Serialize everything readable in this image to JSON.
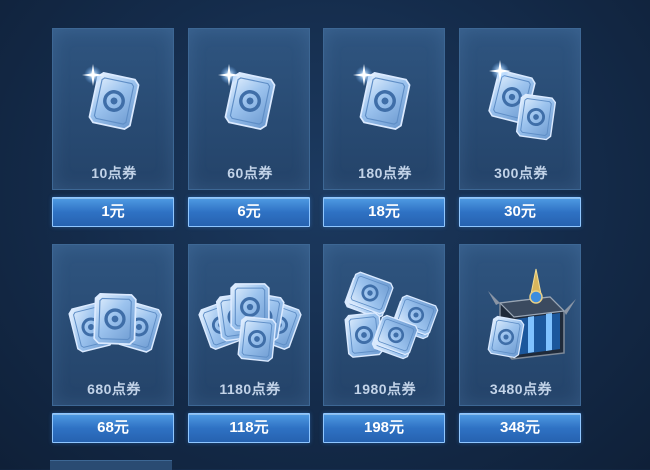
{
  "shop": {
    "items": [
      {
        "amount": "10点券",
        "price": "1元",
        "icon": "single-coupon-icon"
      },
      {
        "amount": "60点券",
        "price": "6元",
        "icon": "single-coupon-icon"
      },
      {
        "amount": "180点券",
        "price": "18元",
        "icon": "single-coupon-icon"
      },
      {
        "amount": "300点券",
        "price": "30元",
        "icon": "double-coupon-icon"
      },
      {
        "amount": "680点券",
        "price": "68元",
        "icon": "coupon-fan-icon"
      },
      {
        "amount": "1180点券",
        "price": "118元",
        "icon": "coupon-large-fan-icon"
      },
      {
        "amount": "1980点券",
        "price": "198元",
        "icon": "coupon-stacks-icon"
      },
      {
        "amount": "3480点券",
        "price": "348元",
        "icon": "treasure-chest-icon"
      }
    ]
  },
  "colors": {
    "background": "#142b4a",
    "tile": "#2a4d76",
    "button": "#3a86d6",
    "button_border": "#8fc6ff",
    "amount_text": "#c2d3e8"
  }
}
